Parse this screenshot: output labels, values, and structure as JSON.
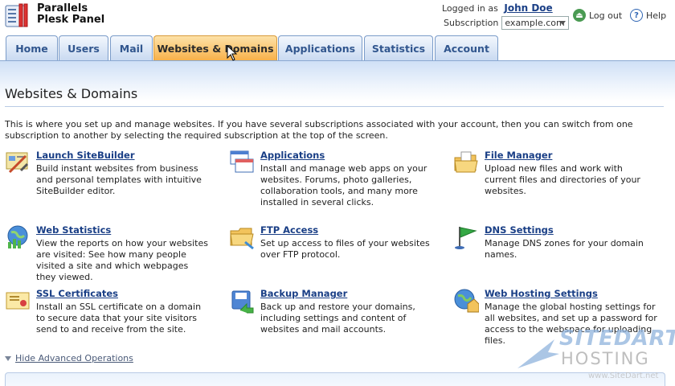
{
  "app": {
    "name_line1": "Parallels",
    "name_line2": "Plesk Panel"
  },
  "header": {
    "logged_in_label": "Logged in as",
    "user_name": "John Doe",
    "subscription_label": "Subscription",
    "subscription_value": "example.com",
    "logout_label": "Log out",
    "help_label": "Help"
  },
  "tabs": [
    {
      "label": "Home",
      "active": false
    },
    {
      "label": "Users",
      "active": false
    },
    {
      "label": "Mail",
      "active": false
    },
    {
      "label": "Websites & Domains",
      "active": true
    },
    {
      "label": "Applications",
      "active": false
    },
    {
      "label": "Statistics",
      "active": false
    },
    {
      "label": "Account",
      "active": false
    }
  ],
  "page": {
    "title": "Websites & Domains",
    "intro": "This is where you set up and manage websites. If you have several subscriptions associated with your account, then you can switch from one subscription to another by selecting the required subscription at the top of the screen."
  },
  "items": [
    {
      "title": "Launch SiteBuilder",
      "desc": "Build instant websites from business and personal templates with intuitive SiteBuilder editor.",
      "icon": "sitebuilder-icon"
    },
    {
      "title": "Applications",
      "desc": "Install and manage web apps on your websites. Forums, photo galleries, collaboration tools, and many more installed in several clicks.",
      "icon": "applications-icon"
    },
    {
      "title": "File Manager",
      "desc": "Upload new files and work with current files and directories of your websites.",
      "icon": "file-manager-icon"
    },
    {
      "title": "Web Statistics",
      "desc": "View the reports on how your websites are visited: See how many people visited a site and which webpages they viewed.",
      "icon": "web-statistics-icon"
    },
    {
      "title": "FTP Access",
      "desc": "Set up access to files of your websites over FTP protocol.",
      "icon": "ftp-folder-icon"
    },
    {
      "title": "DNS Settings",
      "desc": "Manage DNS zones for your domain names.",
      "icon": "dns-flag-icon"
    },
    {
      "title": "SSL Certificates",
      "desc": "Install an SSL certificate on a domain to secure data that your site visitors send to and receive from the site.",
      "icon": "ssl-certificate-icon"
    },
    {
      "title": "Backup Manager",
      "desc": "Back up and restore your domains, including settings and content of websites and mail accounts.",
      "icon": "backup-manager-icon"
    },
    {
      "title": "Web Hosting Settings",
      "desc": "Manage the global hosting settings for all websites, and set up a password for access to the webspace for uploading files.",
      "icon": "web-hosting-globe-icon"
    }
  ],
  "advanced": {
    "label": "Hide Advanced Operations"
  },
  "watermark": {
    "line1": "SITEDART",
    "line2": "HOSTING",
    "line3": "www.SiteDart.net"
  },
  "colors": {
    "link": "#1a3f86",
    "tab_active": "#f8b14a",
    "tab_inactive": "#c9daf1"
  }
}
